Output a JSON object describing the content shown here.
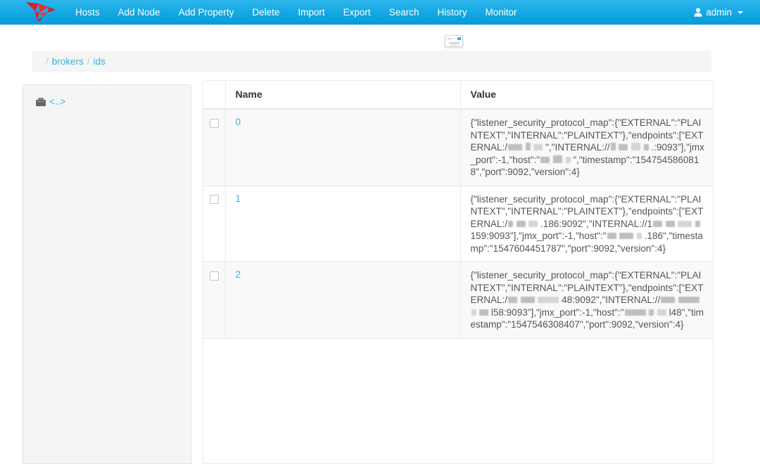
{
  "navbar": {
    "brand_icon": "red-bird-logo",
    "items": [
      {
        "label": "Hosts"
      },
      {
        "label": "Add Node"
      },
      {
        "label": "Add Property"
      },
      {
        "label": "Delete"
      },
      {
        "label": "Import"
      },
      {
        "label": "Export"
      },
      {
        "label": "Search"
      },
      {
        "label": "History"
      },
      {
        "label": "Monitor"
      }
    ],
    "user": {
      "label": "admin",
      "icon": "user-icon",
      "caret": "chevron-down-icon"
    },
    "background_color": "#049cdb",
    "text_color": "#ffffff",
    "logo_color": "#e01b24"
  },
  "floating_card": {
    "icon": "card-preview-icon"
  },
  "breadcrumb": {
    "separator": "/",
    "items": [
      {
        "label": "brokers",
        "link": true
      },
      {
        "label": "ids",
        "link": true
      }
    ],
    "link_color": "#39b3d7"
  },
  "sidebar": {
    "items": [
      {
        "label": "<..>",
        "icon": "folder-icon",
        "link": true
      }
    ]
  },
  "table": {
    "columns": [
      "",
      "Name",
      "Value"
    ],
    "headers": {
      "checkbox": "",
      "name": "Name",
      "value": "Value"
    },
    "rows": [
      {
        "checked": false,
        "name": "0",
        "value_parts": [
          {
            "t": "text",
            "v": "{\"listener_security_protocol_map\":\n{\"EXTERNAL\":\"PLAINTEXT\",\"INTERNAL\":\"PLAINTE\nXT\"},\"endpoints\":\n[\"EXTERNAL:/"
          },
          {
            "t": "redact",
            "v": "/"
          },
          {
            "t": "text",
            "v": "\",\"INTERNAL://"
          },
          {
            "t": "redact",
            "v": "/"
          },
          {
            "t": "text",
            "v": ".:9093\"],\"jmx_port\":-1,\"host\":\""
          },
          {
            "t": "redact",
            "v": "/"
          },
          {
            "t": "text",
            "v": "\",\"timestamp\":\"1547545860818\",\"port\":9092,\"version\":4}"
          }
        ],
        "timestamp": "1547545860818",
        "port": "9092",
        "version": "4",
        "jmx_port": "-1",
        "external_port": "9092",
        "internal_port": "9093"
      },
      {
        "checked": false,
        "name": "1",
        "value_parts": [
          {
            "t": "text",
            "v": "{\"listener_security_protocol_map\":\n{\"EXTERNAL\":\"PLAINTEXT\",\"INTERNAL\":\"PLAINTE\nXT\"},\"endpoints\":\n[\"EXTERNAL:/"
          },
          {
            "t": "redact",
            "v": "/"
          },
          {
            "t": "text",
            "v": ".186:9092\",\"INTERNAL://1"
          },
          {
            "t": "redact",
            "v": "/"
          },
          {
            "t": "text",
            "v": "159:9093\"],\"jmx_port\":-1,\"host\":\""
          },
          {
            "t": "redact",
            "v": "/"
          },
          {
            "t": "text",
            "v": ".186\",\"timestamp\":\"1547604451787\",\"port\":9092,\"version\":4}"
          }
        ],
        "timestamp": "1547604451787",
        "port": "9092",
        "version": "4",
        "jmx_port": "-1",
        "external_port": "9092",
        "internal_port": "9093"
      },
      {
        "checked": false,
        "name": "2",
        "value_parts": [
          {
            "t": "text",
            "v": "{\"listener_security_protocol_map\":\n{\"EXTERNAL\":\"PLAINTEXT\",\"INTERNAL\":\"PLAINTE\nXT\"},\"endpoints\":\n[\"EXTERNAL:/"
          },
          {
            "t": "redact",
            "v": "/"
          },
          {
            "t": "text",
            "v": "48:9092\",\"INTERNAL://"
          },
          {
            "t": "redact",
            "v": "/"
          },
          {
            "t": "text",
            "v": "l58:9093\"],\"jmx_port\":-1,\"host\":\""
          },
          {
            "t": "redact",
            "v": "/"
          },
          {
            "t": "text",
            "v": "l48\",\"timestamp\":\"1547546308407\",\"port\":9092,\"version\":4}"
          }
        ],
        "timestamp": "1547546308407",
        "port": "9092",
        "version": "4",
        "jmx_port": "-1",
        "external_port": "9092",
        "internal_port": "9093"
      }
    ]
  }
}
